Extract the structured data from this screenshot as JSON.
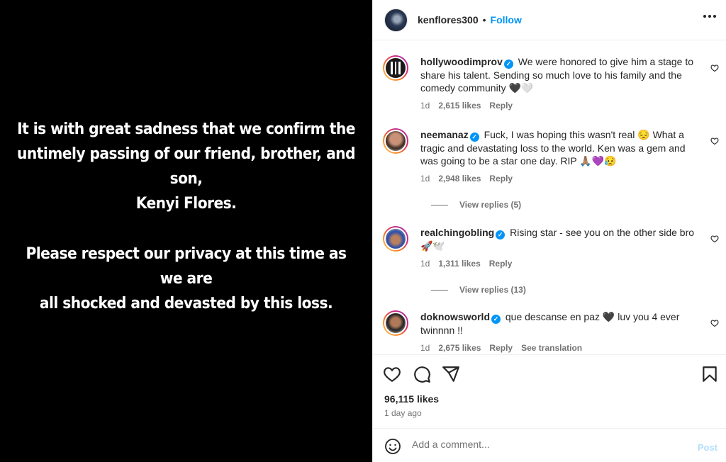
{
  "media": {
    "line1": "It is with great sadness that we confirm the",
    "line2": "untimely passing of our friend, brother, and son,",
    "line3": "Kenyi Flores.",
    "line4": "Please respect our privacy at this time as we are",
    "line5": "all shocked and devasted by this loss."
  },
  "header": {
    "username": "kenflores300",
    "separator": "•",
    "follow_label": "Follow"
  },
  "comments": [
    {
      "username": "hollywoodimprov",
      "text": "We were honored to give him a stage to share his talent. Sending so much love to his family and the comedy community 🖤🤍",
      "time": "1d",
      "likes": "2,615 likes",
      "reply": "Reply"
    },
    {
      "username": "neemanaz",
      "text": "Fuck, I was hoping this wasn't real 😔 What a tragic and devastating loss to the world. Ken was a gem and was going to be a star one day. RIP 🙏🏽💜😥",
      "time": "1d",
      "likes": "2,948 likes",
      "reply": "Reply",
      "view_replies": "View replies (5)"
    },
    {
      "username": "realchingobling",
      "text": "Rising star - see you on the other side bro 🚀🕊️",
      "time": "1d",
      "likes": "1,311 likes",
      "reply": "Reply",
      "view_replies": "View replies (13)"
    },
    {
      "username": "doknowsworld",
      "text": "que descanse en paz 🖤 luv you 4 ever twinnnn !!",
      "time": "1d",
      "likes": "2,675 likes",
      "reply": "Reply",
      "translation": "See translation"
    }
  ],
  "post_stats": {
    "likes": "96,115 likes",
    "time_ago": "1 day ago"
  },
  "add_comment": {
    "placeholder": "Add a comment...",
    "post_label": "Post"
  },
  "colors": {
    "accent": "#0095f6",
    "post_disabled": "#b2dffc",
    "muted_text": "#737373"
  },
  "icons": [
    "verified-badge-icon",
    "more-options-icon",
    "heart-icon",
    "comment-icon",
    "share-icon",
    "bookmark-icon",
    "emoji-icon"
  ]
}
